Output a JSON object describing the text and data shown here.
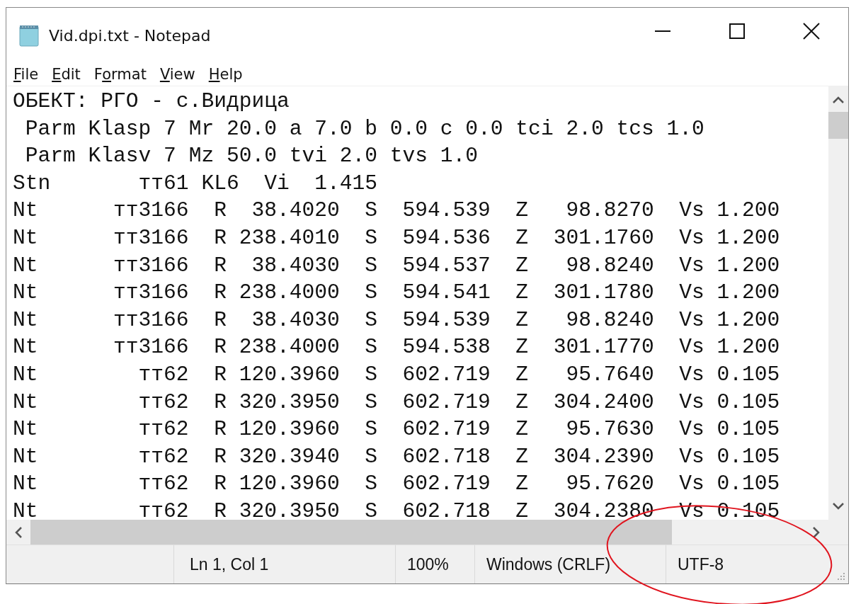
{
  "window": {
    "title": "Vid.dpi.txt - Notepad"
  },
  "menu": [
    {
      "key": "F",
      "post": "ile"
    },
    {
      "key": "E",
      "post": "dit"
    },
    {
      "pre": "F",
      "key": "o",
      "post": "rmat"
    },
    {
      "key": "V",
      "post": "iew"
    },
    {
      "key": "H",
      "post": "elp"
    }
  ],
  "editor": {
    "lines": [
      "ОБЕКТ: РГО - с.Видрица",
      " Parm Klasp 7 Mr 20.0 a 7.0 b 0.0 c 0.0 tci 2.0 tcs 1.0",
      " Parm Klasv 7 Mz 50.0 tvi 2.0 tvs 1.0",
      "Stn       тт61 KL6  Vi  1.415",
      "Nt      тт3166  R  38.4020  S  594.539  Z   98.8270  Vs 1.200",
      "Nt      тт3166  R 238.4010  S  594.536  Z  301.1760  Vs 1.200",
      "Nt      тт3166  R  38.4030  S  594.537  Z   98.8240  Vs 1.200",
      "Nt      тт3166  R 238.4000  S  594.541  Z  301.1780  Vs 1.200",
      "Nt      тт3166  R  38.4030  S  594.539  Z   98.8240  Vs 1.200",
      "Nt      тт3166  R 238.4000  S  594.538  Z  301.1770  Vs 1.200",
      "Nt        тт62  R 120.3960  S  602.719  Z   95.7640  Vs 0.105",
      "Nt        тт62  R 320.3950  S  602.719  Z  304.2400  Vs 0.105",
      "Nt        тт62  R 120.3960  S  602.719  Z   95.7630  Vs 0.105",
      "Nt        тт62  R 320.3940  S  602.718  Z  304.2390  Vs 0.105",
      "Nt        тт62  R 120.3960  S  602.719  Z   95.7620  Vs 0.105",
      "Nt        тт62  R 320.3950  S  602.718  Z  304.2380  Vs 0.105"
    ]
  },
  "status_bar": {
    "position": "Ln 1, Col 1",
    "zoom": "100%",
    "line_endings": "Windows (CRLF)",
    "encoding": "UTF-8"
  }
}
